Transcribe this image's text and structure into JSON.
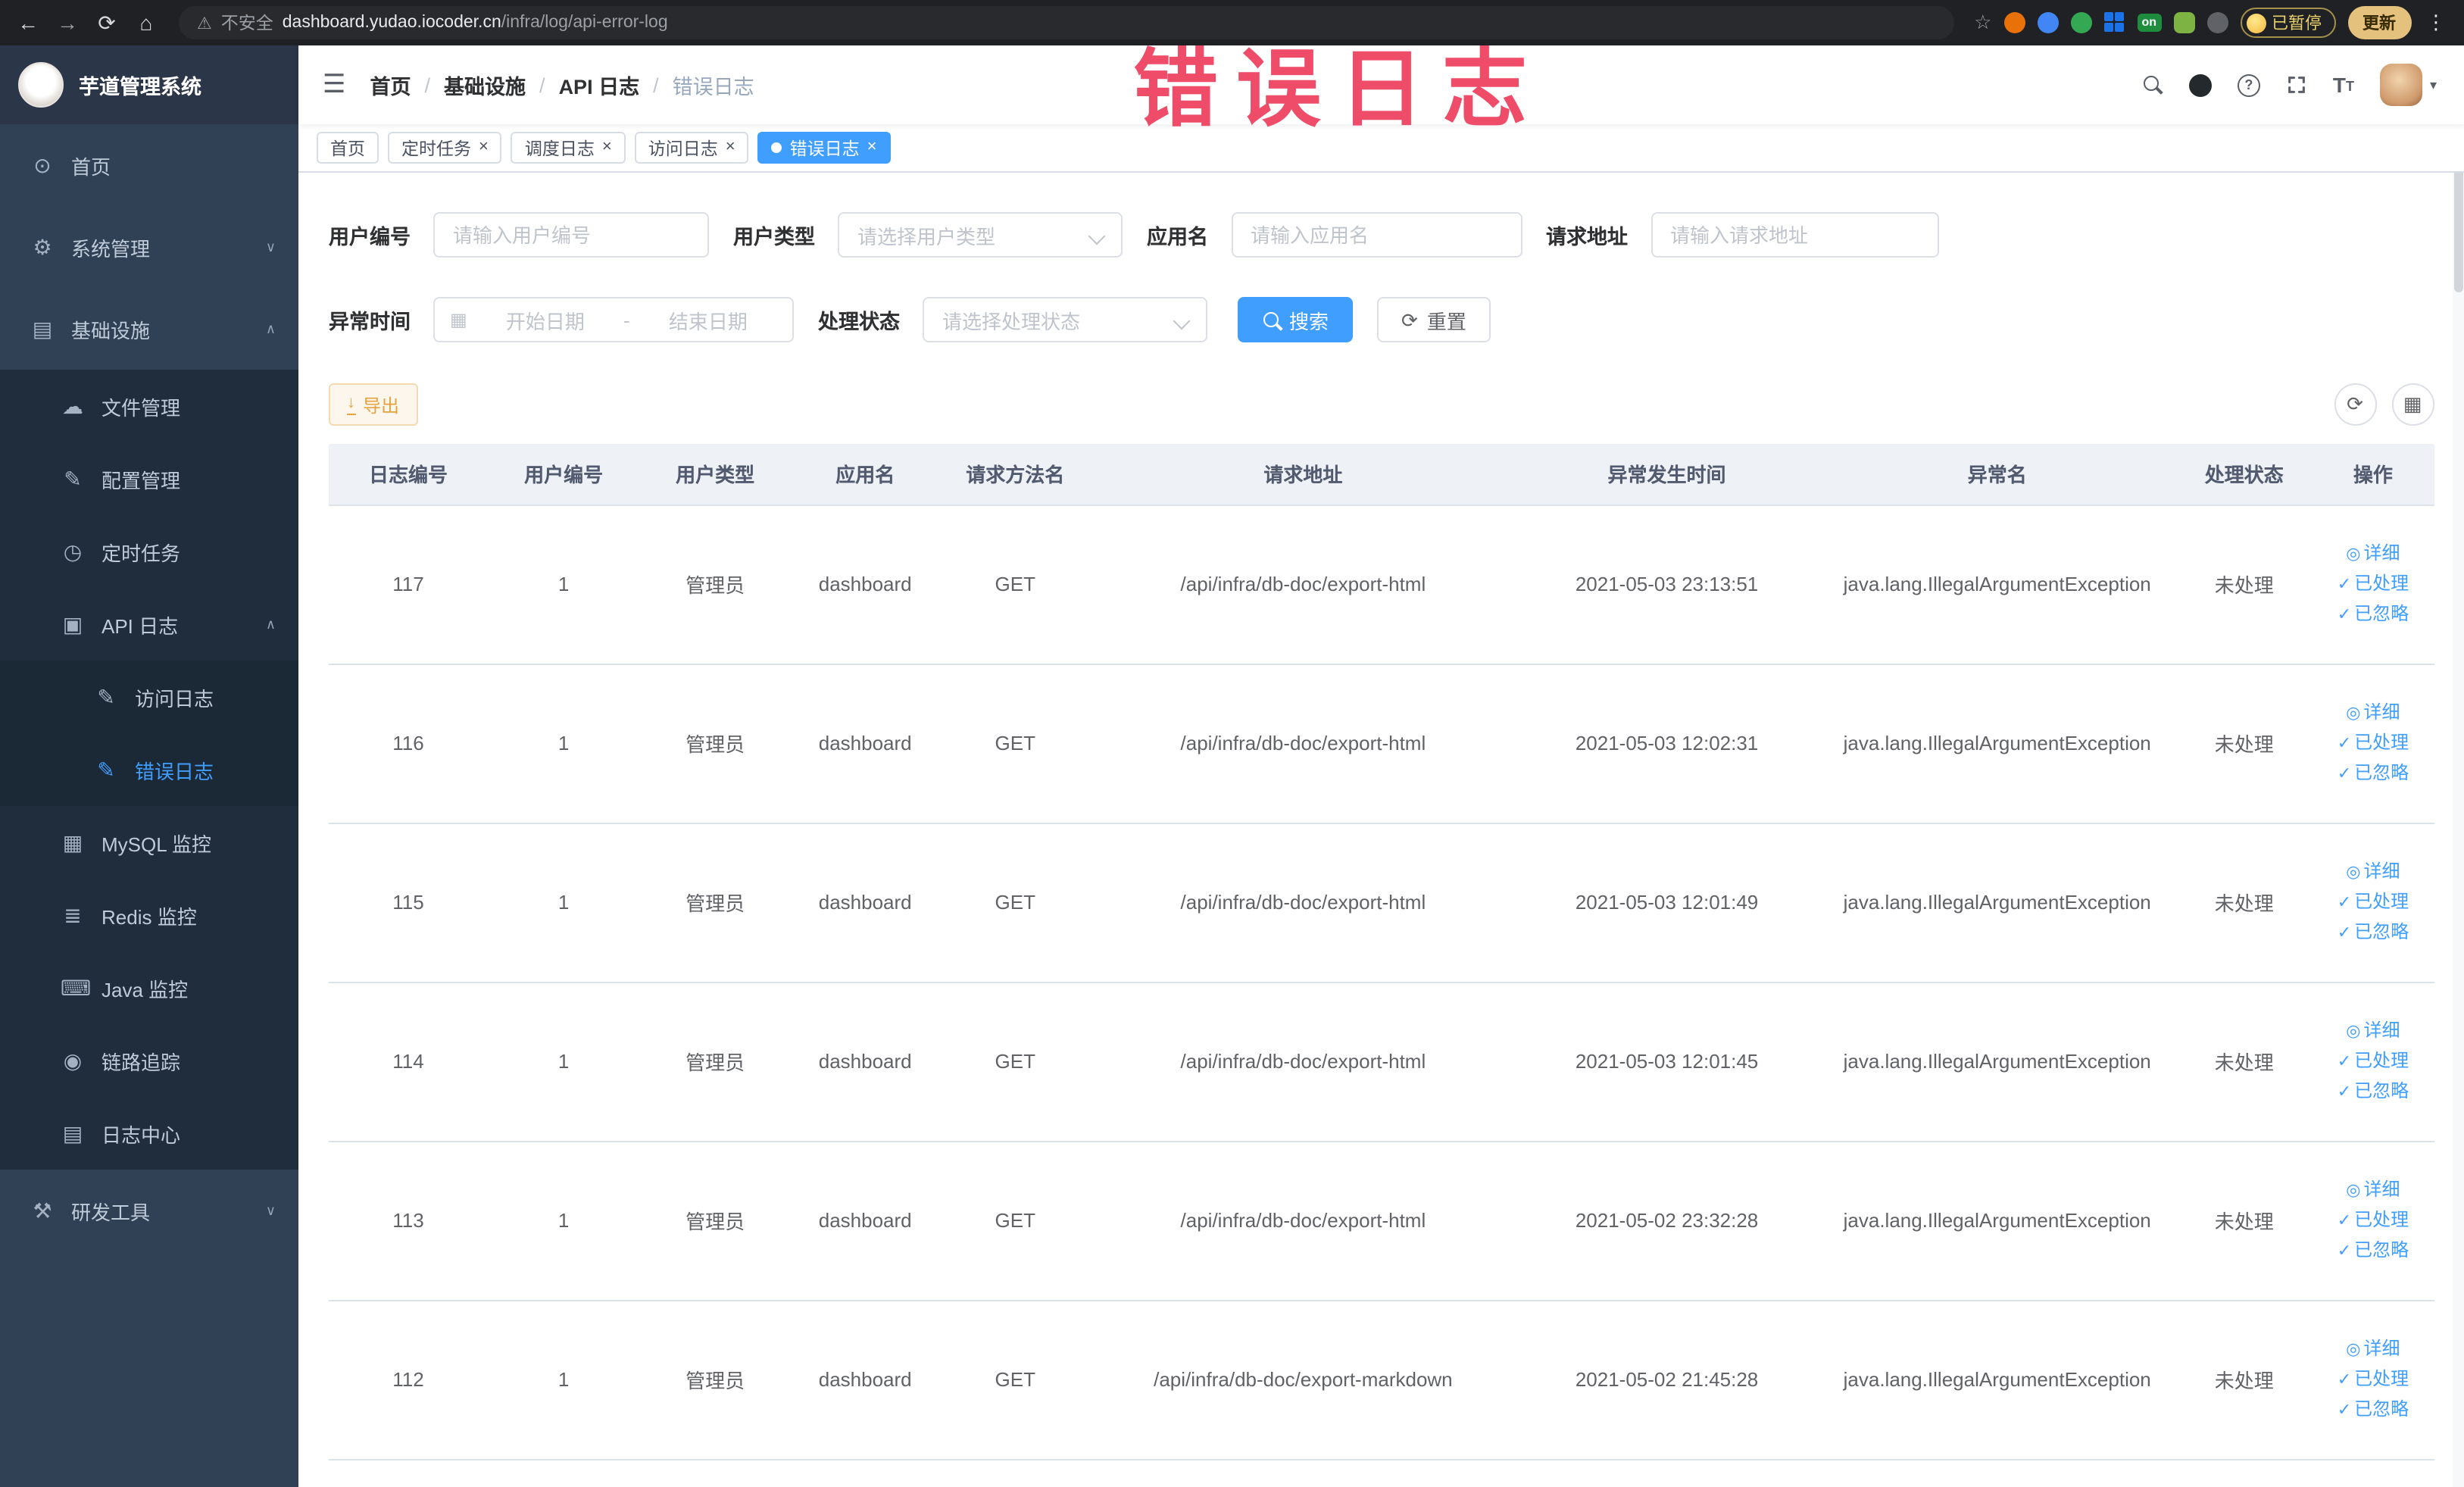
{
  "browser": {
    "security_label": "不安全",
    "url_host": "dashboard.yudao.iocoder.cn",
    "url_path": "/infra/log/api-error-log",
    "extension_on_badge": "on",
    "paused_badge": "已暂停",
    "update_button": "更新"
  },
  "annotation": {
    "text": "错误日志"
  },
  "sidebar": {
    "logo_title": "芋道管理系统",
    "items": [
      {
        "label": "首页"
      },
      {
        "label": "系统管理"
      },
      {
        "label": "基础设施"
      },
      {
        "label": "文件管理"
      },
      {
        "label": "配置管理"
      },
      {
        "label": "定时任务"
      },
      {
        "label": "API 日志"
      },
      {
        "label": "访问日志"
      },
      {
        "label": "错误日志"
      },
      {
        "label": "MySQL 监控"
      },
      {
        "label": "Redis 监控"
      },
      {
        "label": "Java 监控"
      },
      {
        "label": "链路追踪"
      },
      {
        "label": "日志中心"
      },
      {
        "label": "研发工具"
      }
    ]
  },
  "header": {
    "breadcrumb": [
      "首页",
      "基础设施",
      "API 日志",
      "错误日志"
    ],
    "breadcrumb_separator": "/"
  },
  "tabs": [
    {
      "label": "首页"
    },
    {
      "label": "定时任务"
    },
    {
      "label": "调度日志"
    },
    {
      "label": "访问日志"
    },
    {
      "label": "错误日志"
    }
  ],
  "filters": {
    "user_id_label": "用户编号",
    "user_id_placeholder": "请输入用户编号",
    "user_type_label": "用户类型",
    "user_type_placeholder": "请选择用户类型",
    "app_name_label": "应用名",
    "app_name_placeholder": "请输入应用名",
    "request_url_label": "请求地址",
    "request_url_placeholder": "请输入请求地址",
    "time_label": "异常时间",
    "time_start_placeholder": "开始日期",
    "time_separator": "-",
    "time_end_placeholder": "结束日期",
    "status_label": "处理状态",
    "status_placeholder": "请选择处理状态",
    "search_button": "搜索",
    "reset_button": "重置"
  },
  "toolbar": {
    "export_button": "导出"
  },
  "table": {
    "columns": [
      "日志编号",
      "用户编号",
      "用户类型",
      "应用名",
      "请求方法名",
      "请求地址",
      "异常发生时间",
      "异常名",
      "处理状态",
      "操作"
    ],
    "actions": [
      "详细",
      "已处理",
      "已忽略"
    ],
    "rows": [
      {
        "id": "117",
        "user_id": "1",
        "user_type": "管理员",
        "app": "dashboard",
        "method": "GET",
        "url": "/api/infra/db-doc/export-html",
        "time": "2021-05-03 23:13:51",
        "exception": "java.lang.IllegalArgumentException",
        "status": "未处理"
      },
      {
        "id": "116",
        "user_id": "1",
        "user_type": "管理员",
        "app": "dashboard",
        "method": "GET",
        "url": "/api/infra/db-doc/export-html",
        "time": "2021-05-03 12:02:31",
        "exception": "java.lang.IllegalArgumentException",
        "status": "未处理"
      },
      {
        "id": "115",
        "user_id": "1",
        "user_type": "管理员",
        "app": "dashboard",
        "method": "GET",
        "url": "/api/infra/db-doc/export-html",
        "time": "2021-05-03 12:01:49",
        "exception": "java.lang.IllegalArgumentException",
        "status": "未处理"
      },
      {
        "id": "114",
        "user_id": "1",
        "user_type": "管理员",
        "app": "dashboard",
        "method": "GET",
        "url": "/api/infra/db-doc/export-html",
        "time": "2021-05-03 12:01:45",
        "exception": "java.lang.IllegalArgumentException",
        "status": "未处理"
      },
      {
        "id": "113",
        "user_id": "1",
        "user_type": "管理员",
        "app": "dashboard",
        "method": "GET",
        "url": "/api/infra/db-doc/export-html",
        "time": "2021-05-02 23:32:28",
        "exception": "java.lang.IllegalArgumentException",
        "status": "未处理"
      },
      {
        "id": "112",
        "user_id": "1",
        "user_type": "管理员",
        "app": "dashboard",
        "method": "GET",
        "url": "/api/infra/db-doc/export-markdown",
        "time": "2021-05-02 21:45:28",
        "exception": "java.lang.IllegalArgumentException",
        "status": "未处理"
      }
    ]
  },
  "icons": {
    "back": "←",
    "forward": "→",
    "reload": "⟳",
    "home": "⌂",
    "warning": "⚠",
    "star": "☆",
    "menu_dots": "⋮",
    "hamburger": "☰",
    "chevron_down": "∨",
    "chevron_up": "∧",
    "caret_down": "▾",
    "close": "×",
    "dashboard": "⊙",
    "gear": "⚙",
    "infrastructure": "▤",
    "file": "☁",
    "config": "✎",
    "job": "◷",
    "api_log": "▣",
    "doc_edit": "✎",
    "mysql": "▦",
    "redis": "≣",
    "java": "⌨",
    "tracing": "◉",
    "log_center": "▤",
    "devtools": "⚒",
    "calendar": "▦",
    "download": "↓",
    "refresh": "⟳",
    "columns": "▦",
    "eye": "◎",
    "check": "✓"
  },
  "colors": {
    "accent_blue": "#409EFF",
    "warning_orange": "#e6a23c",
    "sidebar_bg": "#304156",
    "chrome_bg": "#202124",
    "annotation_red": "#ee3e5e"
  }
}
